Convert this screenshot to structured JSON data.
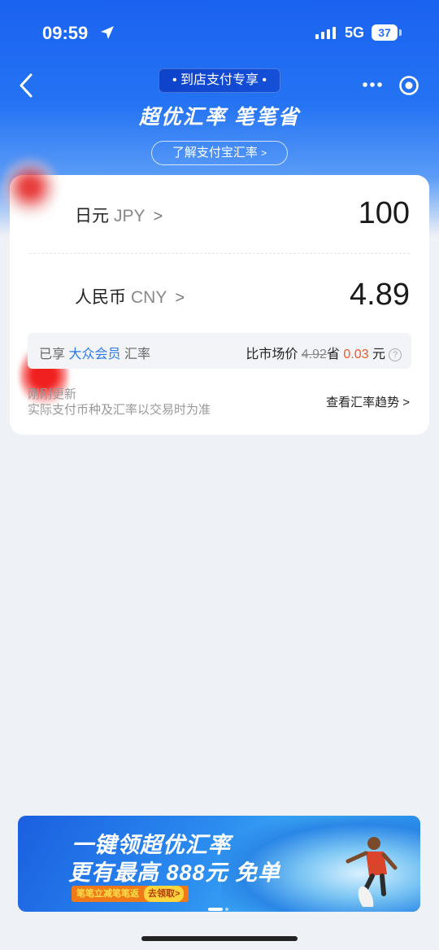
{
  "status_bar": {
    "time": "09:59",
    "network": "5G",
    "battery": "37"
  },
  "header": {
    "tag": "• 到店支付专享 •",
    "headline": "超优汇率 笔笔省",
    "learn_link": "了解支付宝汇率",
    "chevron": "〉"
  },
  "converter": {
    "from": {
      "name": "日元",
      "code": "JPY",
      "amount": "100"
    },
    "to": {
      "name": "人民币",
      "code": "CNY",
      "amount": "4.89"
    },
    "chevron": ">"
  },
  "perk": {
    "prefix": "已享",
    "member": "大众会员",
    "suffix": "汇率",
    "market_label": "比市场价",
    "market_price": "4.92",
    "save_label": "省",
    "save_amount": "0.03",
    "unit": "元",
    "help": "?"
  },
  "footer": {
    "updated": "刚刚更新",
    "note": "实际支付币种及汇率以交易时为准",
    "trend_link": "查看汇率趋势 >"
  },
  "banner": {
    "line1": "一键领超优汇率",
    "line2": "更有最高 888元 免单",
    "sub": "笔笔立减笔笔返",
    "cta": "去领取>"
  },
  "colors": {
    "brand": "#1a62f0",
    "highlight": "#2a7ae8",
    "save": "#f05a23"
  }
}
